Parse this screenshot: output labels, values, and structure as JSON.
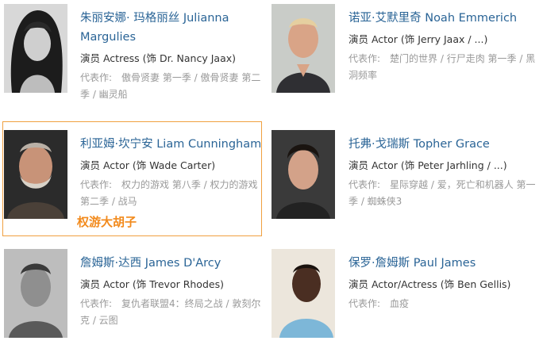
{
  "cast": [
    {
      "name": "朱丽安娜· 玛格丽丝 Julianna Margulies",
      "role": "演员 Actress (饰 Dr. Nancy Jaax)",
      "works_label": "代表作:",
      "works": "傲骨贤妻 第一季 / 傲骨贤妻 第二季 / 幽灵船"
    },
    {
      "name": "诺亚·艾默里奇 Noah Emmerich",
      "role": "演员 Actor (饰 Jerry Jaax / ...)",
      "works_label": "代表作:",
      "works": "楚门的世界 / 行尸走肉 第一季 / 黑洞频率"
    },
    {
      "name": "利亚姆·坎宁安 Liam Cunningham",
      "role": "演员 Actor (饰 Wade Carter)",
      "works_label": "代表作:",
      "works": "权力的游戏 第八季 / 权力的游戏 第二季 / 战马"
    },
    {
      "name": "托弗·戈瑞斯 Topher Grace",
      "role": "演员 Actor (饰 Peter Jarhling / ...)",
      "works_label": "代表作:",
      "works": "星际穿越 / 爱，死亡和机器人 第一季 / 蜘蛛侠3"
    },
    {
      "name": "詹姆斯·达西 James D'Arcy",
      "role": "演员 Actor (饰 Trevor Rhodes)",
      "works_label": "代表作:",
      "works": "复仇者联盟4：终局之战 / 敦刻尔克 / 云图"
    },
    {
      "name": "保罗·詹姆斯 Paul James",
      "role": "演员 Actor/Actress (饰 Ben Gellis)",
      "works_label": "代表作:",
      "works": "血疫"
    }
  ],
  "annotation": "权游大胡子",
  "colors": {
    "link": "#2a6496",
    "highlight_border": "#f0a040",
    "annotation": "#f28a1c"
  }
}
